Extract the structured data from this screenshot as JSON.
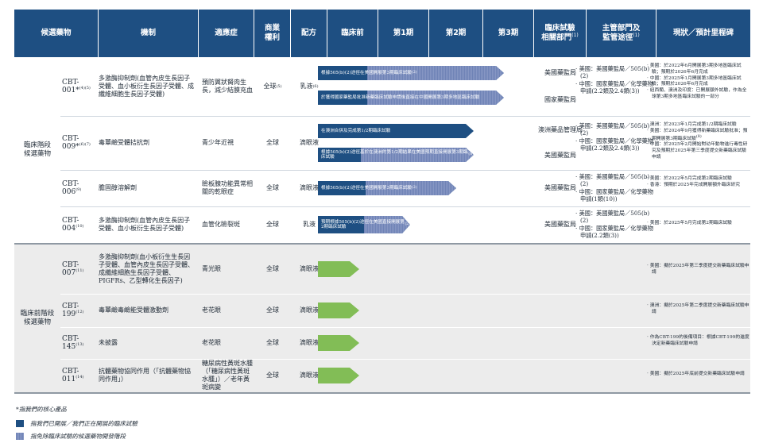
{
  "colors": {
    "header": "#1e4f82",
    "bar": "#1e4f82",
    "hatch": "#7f91c0",
    "preclinical_arrow": "#82bd56",
    "band": "#ececec"
  },
  "headers": {
    "candidate": "候選藥物",
    "mechanism": "機制",
    "indication": "適應症",
    "rights_l1": "商業",
    "rights_l2": "權利",
    "formulation": "配方",
    "preclinical": "臨床前",
    "phase1": "第1期",
    "phase2": "第2期",
    "phase3": "第3期",
    "dept_l1": "臨床試驗",
    "dept_l2": "相關部門",
    "dept_sup": "(1)",
    "reg_l1": "主管部門及",
    "reg_l2": "監管途徑",
    "reg_sup": "(1)",
    "status": "現狀／預計里程碑"
  },
  "groups": {
    "clinical_l1": "臨床階段",
    "clinical_l2": "候選藥物",
    "pre_l1": "臨床前階段",
    "pre_l2": "候選藥物"
  },
  "rows": [
    {
      "name_l1": "CBT-",
      "name_l2": "001*",
      "sup": "(4)(5)",
      "mechanism": "多激酶抑制劑(血管內皮生長因子受體、血小板衍生長因子受體、成纖維細胞生長因子受體)",
      "indication": "預防翼狀胬肉生長，減少結膜充血",
      "rights": "全球",
      "rights_sup": "(5)",
      "formulation": "乳液",
      "formulation_sup": "(6)",
      "bar1": "根據505(b)(2)途徑在美國開展第3期臨床試驗",
      "bar1_sup": "(2)",
      "bar2": "於獲得國家藥監局批准新藥臨床試驗申請後直接在中國開展第3期多地區臨床試驗",
      "dept1": "美國藥監局",
      "dept2": "國家藥監局",
      "reg1": "美國：美國藥監局／505(b)(2)",
      "reg2": "中國：國家藥監局／化學藥物申請(2.2類及2.4類(3))",
      "ms1": "美國：於2022年6月開展第3期多地區臨床試驗；預期於2026年6月完成",
      "ms2": "中國：於2025年1月開展第3期多地區臨床試驗；預期於2026年6月完成",
      "ms3": "紐西蘭、澳洲及印度：已開展額外試驗，作為全球第3期多地區臨床試驗的一部分"
    },
    {
      "name_l1": "CBT-",
      "name_l2": "009*",
      "sup": "(6)(7)",
      "mechanism": "毒蕈鹼受體拮抗劑",
      "indication": "青少年近視",
      "rights": "全球",
      "formulation": "滴眼液",
      "bar1": "在澳洲合併及完成第1/2期臨床試驗",
      "bar2": "根據505(b)(2)途徑基於在澳洲的第1/2期結果在美國預期直接開展第3期臨床試驗",
      "bar2_sup": "(8)",
      "dept1": "澳洲藥品管理局",
      "dept2": "美國藥監局",
      "reg1": "美國：美國藥監局／505(b)(2)",
      "reg2": "中國：國家藥監局／化學藥物申請(2.2類及2.4類(3))",
      "ms1": "澳洲：於2023年1月完成第1/2期臨床試驗",
      "ms2": "美國：於2024年9月獲得新藥臨床試驗批准；預期開展第3期臨床試驗",
      "ms2_sup": "(8)",
      "ms3": "中國：於2025年2月開始對幼年動物進行毒性研究及預期於2025年第三季度提交新藥臨床試驗申請"
    },
    {
      "name_l1": "CBT-",
      "name_l2": "006",
      "sup": "(9)",
      "mechanism": "膽固醇溶解劑",
      "indication": "瞼板腺功能異常相關的乾眼症",
      "rights": "全球",
      "formulation": "滴眼液",
      "bar1": "根據505(b)(2)途徑在美國開展第3期臨床試驗",
      "bar1_sup": "(2)",
      "dept1": "美國藥監局",
      "reg1": "美國：美國藥監局／505(b)(2)",
      "reg2": "中國：國家藥監局／化學藥物申請(1類(10))",
      "ms1": "美國：於2022年5月完成第2期臨床試驗",
      "ms2": "香港：預期於2025年完成開展額外臨床研究"
    },
    {
      "name_l1": "CBT-",
      "name_l2": "004",
      "sup": "(10)",
      "mechanism": "多激酶抑制劑(血管內皮生長因子受體、血小板衍生長因子受體)",
      "indication": "血管化瞼裂斑",
      "rights": "全球",
      "formulation": "乳液",
      "bar1": "預期根據505(b)(2)途徑在美國直接開展第2期臨床試驗",
      "bar1_sup": "(2)",
      "dept1": "美國藥監局",
      "reg1": "美國：美國藥監局／505(b)(2)",
      "reg2": "中國：國家藥監局／化學藥物申請(2.2類(3))",
      "ms1": "美國：於2025年5月完成第2期臨床試驗"
    },
    {
      "name_l1": "CBT-",
      "name_l2": "007",
      "sup": "(11)",
      "mechanism": "多激酶抑制劑(血小板衍生生長因子受體、血管內皮生長因子受體、成纖維細胞生長因子受體、PIGFRs、乙型轉化生長因子)",
      "indication": "青光眼",
      "rights": "全球",
      "formulation": "滴眼液",
      "ms1": "美國：擬於2025年第三季度提交新藥臨床試驗申請"
    },
    {
      "name_l1": "CBT-",
      "name_l2": "199",
      "sup": "(12)",
      "mechanism": "毒蕈鹼毒鹼能受體激動劑",
      "indication": "老花眼",
      "rights": "全球",
      "formulation": "滴眼液",
      "ms1": "澳洲：擬於2025年第二季度提交新藥臨床試驗申請"
    },
    {
      "name_l1": "CBT-",
      "name_l2": "145",
      "sup": "(13)",
      "mechanism": "未披露",
      "indication": "老花眼",
      "rights": "全球",
      "formulation": "滴眼液",
      "ms1": "作為CBT-199的後備項目：根據CBT-199的進度決定新藥臨床試驗申請"
    },
    {
      "name_l1": "CBT-",
      "name_l2": "011",
      "sup": "(14)",
      "mechanism": "抗體藥物協同作用（「抗體藥物協同作用」）",
      "indication": "糖尿病性黃斑水腫（「糖尿病性黃斑水腫」）／老年黃斑病變",
      "rights": "全球",
      "formulation": "滴眼液",
      "ms1": "美國：擬於2025年底前提交新藥臨床試驗申請"
    }
  ],
  "legend": {
    "core": "*指我們的核心產品",
    "solid": "指我們已開展／我們正在開展的臨床試驗",
    "hatch": "指免除臨床試驗的候選藥物開發階段"
  }
}
